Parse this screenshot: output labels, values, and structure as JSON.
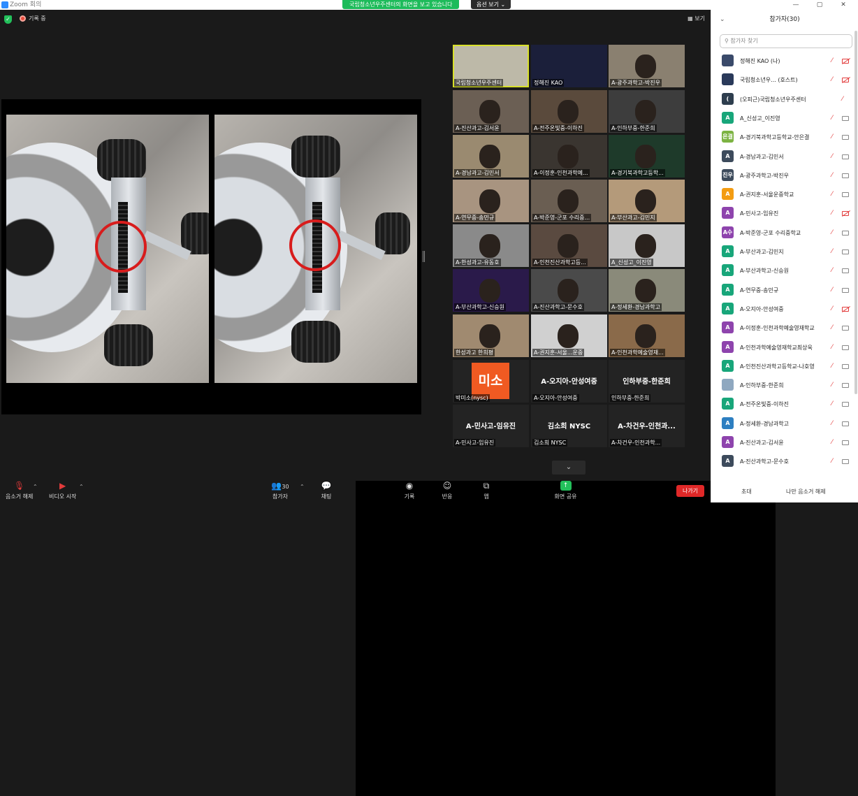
{
  "window": {
    "title": "Zoom 회의",
    "controls": [
      "—",
      "▢",
      "✕"
    ]
  },
  "banner": {
    "sharing_text": "국립청소년우주센터의 화면을 보고 있습니다",
    "view_options": "옵션 보기 ⌄"
  },
  "top": {
    "recording": "기록 중",
    "view": "보기"
  },
  "gallery": {
    "tiles": [
      "국립청소년우주센터",
      "정해진 KAO",
      "A-광주과학고-박진우",
      "A-진산과고-김서윤",
      "A-전주온빛중-이하진",
      "A-인하부중-한준희",
      "A-경남과고-김민서",
      "A-이정훈-인천과학예...",
      "A-경기북과학고등학...",
      "A-연무중-송민규",
      "A-박준영-군포 수리중...",
      "A-부산과고-김민지",
      "A-한성과고-유동호",
      "A-인천진산과학고등...",
      "A_신성고_이진영",
      "A-부산과학고-신승원",
      "A-진산과학고-문수호",
      "A-정세환-경남과학고",
      "한성과고 한희평",
      "A-권지훈-서울...운중",
      "A-인천과학예술영재..."
    ],
    "text_tiles": [
      {
        "big": "미소",
        "name": "박미소(nysc)"
      },
      {
        "big": "A-오지아-안성여중",
        "name": "A-오지아-안성여중"
      },
      {
        "big": "인하부중-한준희",
        "name": "인하부중-한준희"
      },
      {
        "big": "A-민사고-임유진",
        "name": "A-민사고-임유진"
      },
      {
        "big": "김소희 NYSC",
        "name": "김소희 NYSC"
      },
      {
        "big": "A-차건우-인천과...",
        "name": "A-차건우-인천과학..."
      }
    ]
  },
  "toolbar": {
    "unmute": "음소거 해제",
    "start_video": "비디오 시작",
    "participants": "참가자",
    "participants_count": "30",
    "chat": "채팅",
    "share": "화면 공유",
    "record": "기록",
    "reactions": "반응",
    "apps": "앱",
    "leave": "나가기"
  },
  "panel": {
    "title": "참가자(30)",
    "search_placeholder": "참가자 찾기",
    "invite": "초대",
    "unmute_me": "나만 음소거 해제",
    "participants": [
      {
        "name": "정해진 KAO (나)",
        "avatar": "",
        "color": "#3a4a6a"
      },
      {
        "name": "국립청소년우... (호스트)",
        "avatar": "",
        "color": "#2a3a5a"
      },
      {
        "name": "(오피근)국립청소년우주센터",
        "avatar": "(",
        "color": "#2e3e4e"
      },
      {
        "name": "A_신성고_이진영",
        "avatar": "A",
        "color": "#18a67a"
      },
      {
        "name": "A-경기북과학고등학교-안은결",
        "avatar": "은결",
        "color": "#7cb342"
      },
      {
        "name": "A-경남과고-김민서",
        "avatar": "A",
        "color": "#3d4b5c"
      },
      {
        "name": "A-광주과학고-박진우",
        "avatar": "진우",
        "color": "#3d4b5c"
      },
      {
        "name": "A-권지훈-서울운중학교",
        "avatar": "A",
        "color": "#f39c12"
      },
      {
        "name": "A-민사고-임유진",
        "avatar": "A",
        "color": "#8e44ad"
      },
      {
        "name": "A-박준영-군포 수리중학교",
        "avatar": "A수",
        "color": "#8e44ad"
      },
      {
        "name": "A-부산과고-김민지",
        "avatar": "A",
        "color": "#18a67a"
      },
      {
        "name": "A-부산과학고-신승원",
        "avatar": "A",
        "color": "#18a67a"
      },
      {
        "name": "A-연무중-송민규",
        "avatar": "A",
        "color": "#18a67a"
      },
      {
        "name": "A-오지아-안성여중",
        "avatar": "A",
        "color": "#18a67a"
      },
      {
        "name": "A-이정훈-인천과학예술영재학교",
        "avatar": "A",
        "color": "#8e44ad"
      },
      {
        "name": "A-인천과학예술영재학교최상욱",
        "avatar": "A",
        "color": "#8e44ad"
      },
      {
        "name": "A-인천진산과학고등학교-나호영",
        "avatar": "A",
        "color": "#18a67a"
      },
      {
        "name": "A-인하부중-한준희",
        "avatar": "",
        "color": "#8fa8c0"
      },
      {
        "name": "A-전주온빛중-이하진",
        "avatar": "A",
        "color": "#18a67a"
      },
      {
        "name": "A-정세환-경남과학고",
        "avatar": "A",
        "color": "#2d7fc1"
      },
      {
        "name": "A-진산과고-김서윤",
        "avatar": "A",
        "color": "#8e44ad"
      },
      {
        "name": "A-진산과학고-문수호",
        "avatar": "A",
        "color": "#3d4b5c"
      }
    ]
  }
}
